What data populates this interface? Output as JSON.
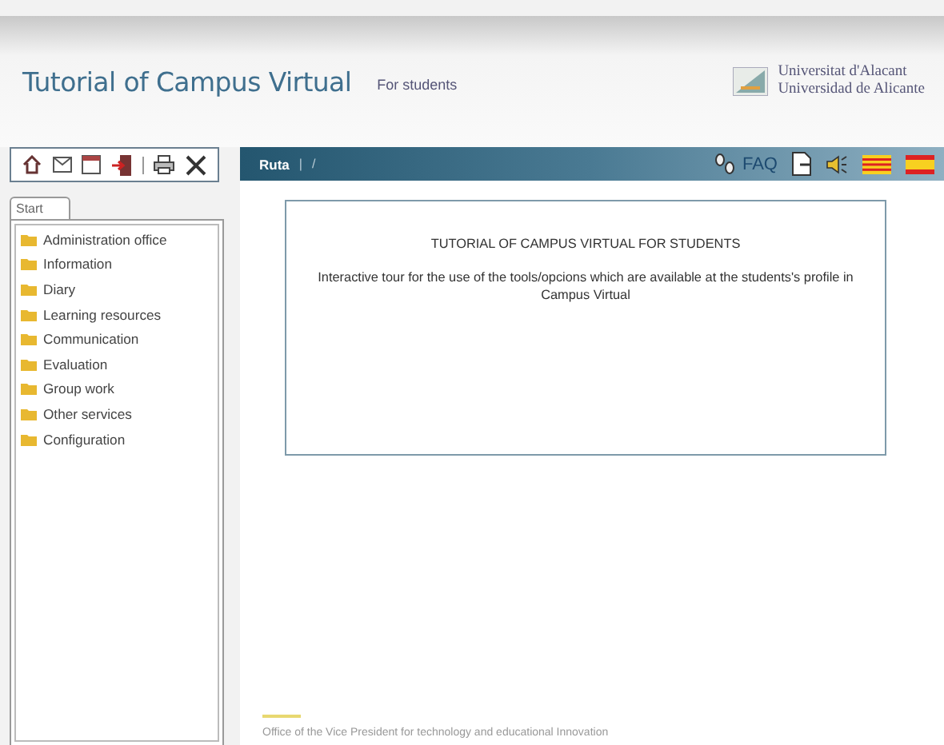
{
  "header": {
    "title": "Tutorial of Campus Virtual",
    "subtitle": "For students",
    "university": [
      "Universitat d'Alacant",
      "Universidad de Alicante"
    ]
  },
  "breadcrumb": {
    "label": "Ruta",
    "separator": "|",
    "path": "/"
  },
  "topbar": {
    "faq": "FAQ"
  },
  "sidebar": {
    "tab": "Start",
    "items": [
      {
        "label": "Administration office"
      },
      {
        "label": "Information"
      },
      {
        "label": "Diary"
      },
      {
        "label": "Learning resources"
      },
      {
        "label": "Communication"
      },
      {
        "label": "Evaluation"
      },
      {
        "label": "Group work"
      },
      {
        "label": "Other services"
      },
      {
        "label": "Configuration"
      }
    ]
  },
  "content": {
    "heading": "TUTORIAL OF CAMPUS VIRTUAL FOR STUDENTS",
    "text": "Interactive tour for the use of the tools/opcions which are available at the students's profile in Campus Virtual"
  },
  "footer": {
    "text": "Office of the Vice President for technology and educational Innovation"
  }
}
